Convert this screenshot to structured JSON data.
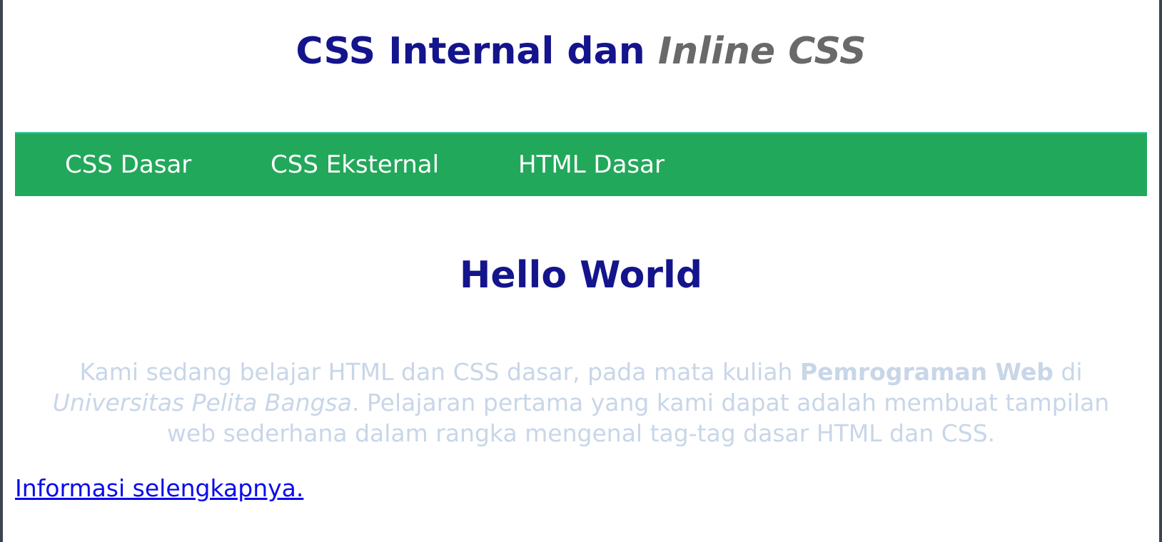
{
  "header": {
    "title_main": "CSS Internal dan ",
    "title_emphasis": "Inline CSS"
  },
  "nav": {
    "items": [
      {
        "label": "CSS Dasar"
      },
      {
        "label": "CSS Eksternal"
      },
      {
        "label": "HTML Dasar"
      }
    ]
  },
  "main": {
    "heading": "Hello World",
    "paragraph": {
      "part1": "Kami sedang belajar HTML dan CSS dasar, pada mata kuliah ",
      "bold": "Pemrograman Web",
      "part2": " di ",
      "italic": "Universitas Pelita Bangsa",
      "part3": ". Pelajaran pertama yang kami dapat adalah membuat tampilan web sederhana dalam rangka mengenal tag-tag dasar HTML dan CSS."
    },
    "more_link": "Informasi selengkapnya."
  },
  "colors": {
    "heading": "#14148c",
    "emphasis": "#696969",
    "nav_background": "#22a85a",
    "paragraph_text": "#c8d6e8",
    "link": "#0a0aee",
    "frame": "#3c4454"
  }
}
